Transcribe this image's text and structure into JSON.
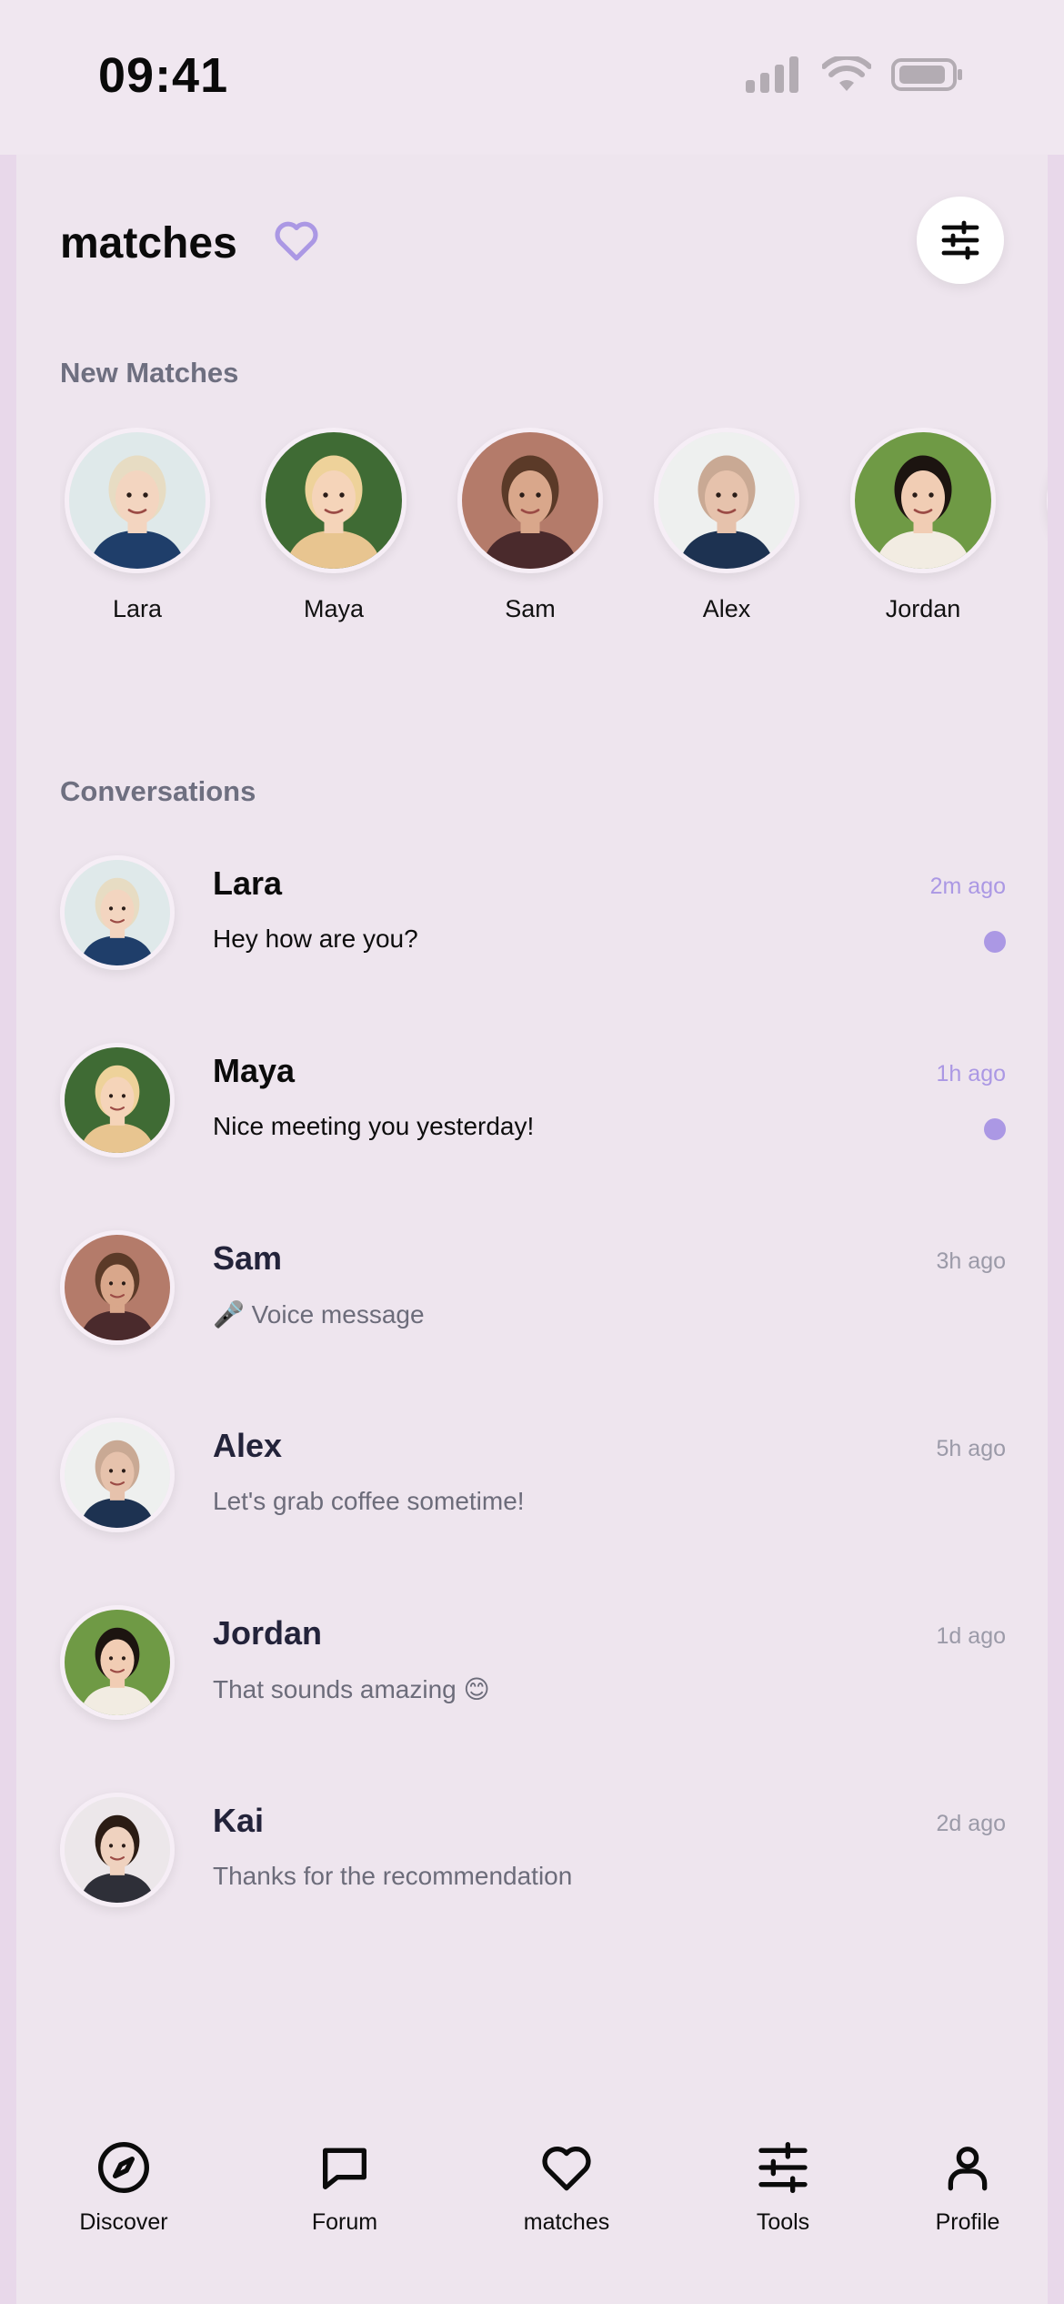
{
  "status_bar": {
    "time": "09:41",
    "icons": [
      "signal-icon",
      "wifi-icon",
      "battery-icon"
    ]
  },
  "header": {
    "title": "matches",
    "accent_icon": "heart-outline-icon",
    "filter_icon": "sliders-icon"
  },
  "new_matches": {
    "title": "New Matches",
    "items": [
      {
        "name": "Lara",
        "hair": "#e7dcc3",
        "skin": "#f3d5c0",
        "bg": "#dfe9ea",
        "shirt": "#1f3e6a"
      },
      {
        "name": "Maya",
        "hair": "#eed29a",
        "skin": "#f5d4b9",
        "bg": "#3f6b34",
        "shirt": "#e8c590"
      },
      {
        "name": "Sam",
        "hair": "#5b3a28",
        "skin": "#d9a78b",
        "bg": "#b47b6a",
        "shirt": "#4a2a2c"
      },
      {
        "name": "Alex",
        "hair": "#c9a994",
        "skin": "#e6c2ac",
        "bg": "#eef0ef",
        "shirt": "#1d3251"
      },
      {
        "name": "Jordan",
        "hair": "#1c1410",
        "skin": "#f1cdb4",
        "bg": "#6f9a45",
        "shirt": "#f2ece2"
      }
    ]
  },
  "conversations": {
    "title": "Conversations",
    "items": [
      {
        "name": "Lara",
        "message": "Hey how are you?",
        "time": "2m ago",
        "unread": true
      },
      {
        "name": "Maya",
        "message": "Nice meeting you yesterday!",
        "time": "1h ago",
        "unread": true
      },
      {
        "name": "Sam",
        "message": "🎤 Voice message",
        "time": "3h ago",
        "unread": false
      },
      {
        "name": "Alex",
        "message": "Let's grab coffee sometime!",
        "time": "5h ago",
        "unread": false
      },
      {
        "name": "Jordan",
        "message": "That sounds amazing 😊",
        "time": "1d ago",
        "unread": false
      },
      {
        "name": "Kai",
        "message": "Thanks for the recommendation",
        "time": "2d ago",
        "unread": false
      }
    ]
  },
  "nav": {
    "items": [
      {
        "label": "Discover",
        "icon": "compass-icon"
      },
      {
        "label": "Forum",
        "icon": "chat-bubble-icon"
      },
      {
        "label": "matches",
        "icon": "heart-icon"
      },
      {
        "label": "Tools",
        "icon": "sliders-icon"
      },
      {
        "label": "Profile",
        "icon": "person-icon"
      }
    ]
  },
  "colors": {
    "accent": "#ab98e4",
    "panel": "#eee5ee",
    "edge": "#e8d8ea"
  }
}
